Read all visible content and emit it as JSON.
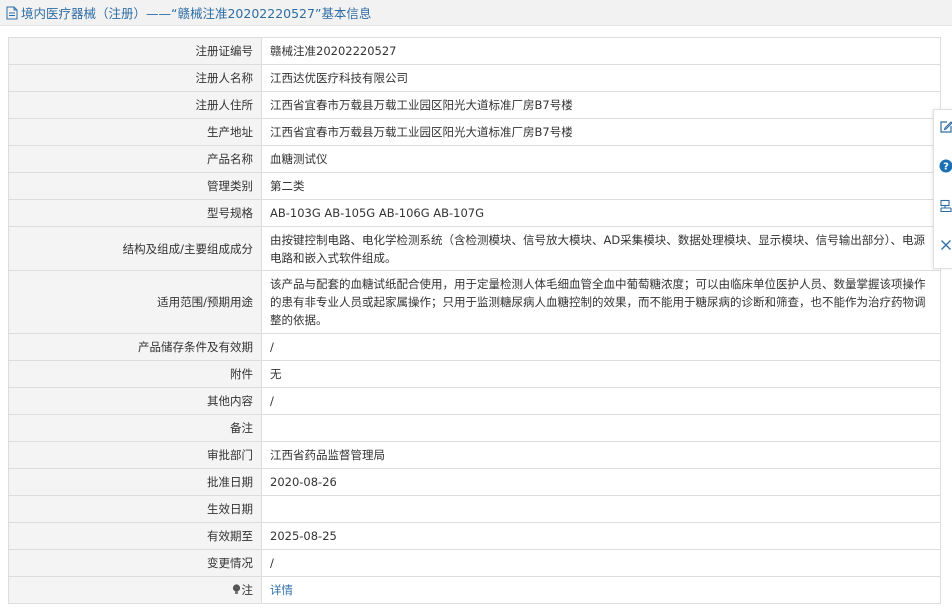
{
  "header": {
    "title": "境内医疗器械（注册）——“赣械注准20202220527”基本信息",
    "icon": "document-icon"
  },
  "rows": [
    {
      "label": "注册证编号",
      "value": "赣械注准20202220527"
    },
    {
      "label": "注册人名称",
      "value": "江西达优医疗科技有限公司"
    },
    {
      "label": "注册人住所",
      "value": "江西省宜春市万载县万载工业园区阳光大道标准厂房B7号楼"
    },
    {
      "label": "生产地址",
      "value": "江西省宜春市万载县万载工业园区阳光大道标准厂房B7号楼"
    },
    {
      "label": "产品名称",
      "value": "血糖测试仪"
    },
    {
      "label": "管理类别",
      "value": "第二类"
    },
    {
      "label": "型号规格",
      "value": "AB-103G AB-105G AB-106G AB-107G"
    },
    {
      "label": "结构及组成/主要组成成分",
      "value": "由按键控制电路、电化学检测系统（含检测模块、信号放大模块、AD采集模块、数据处理模块、显示模块、信号输出部分）、电源电路和嵌入式软件组成。"
    },
    {
      "label": "适用范围/预期用途",
      "value": "该产品与配套的血糖试纸配合使用，用于定量检测人体毛细血管全血中葡萄糖浓度；可以由临床单位医护人员、数量掌握该项操作的患有非专业人员或起家属操作；只用于监测糖尿病人血糖控制的效果，而不能用于糖尿病的诊断和筛查，也不能作为治疗药物调整的依据。"
    },
    {
      "label": "产品储存条件及有效期",
      "value": "/"
    },
    {
      "label": "附件",
      "value": "无"
    },
    {
      "label": "其他内容",
      "value": "/"
    },
    {
      "label": "备注",
      "value": ""
    },
    {
      "label": "审批部门",
      "value": "江西省药品监督管理局"
    },
    {
      "label": "批准日期",
      "value": "2020-08-26"
    },
    {
      "label": "生效日期",
      "value": ""
    },
    {
      "label": "有效期至",
      "value": "2025-08-25"
    },
    {
      "label": "变更情况",
      "value": "/"
    }
  ],
  "note_row": {
    "label": "注",
    "icon": "lightbulb-icon",
    "link": "详情"
  },
  "toolbar": {
    "icons": [
      "edit-icon",
      "help-icon",
      "share-icon",
      "close-icon"
    ]
  },
  "colors": {
    "link": "#2e6da4",
    "label_bg": "#f4f4f4",
    "header_bg": "#f2f2f2",
    "border": "#dddddd",
    "help_badge": "#1a6fb5"
  }
}
